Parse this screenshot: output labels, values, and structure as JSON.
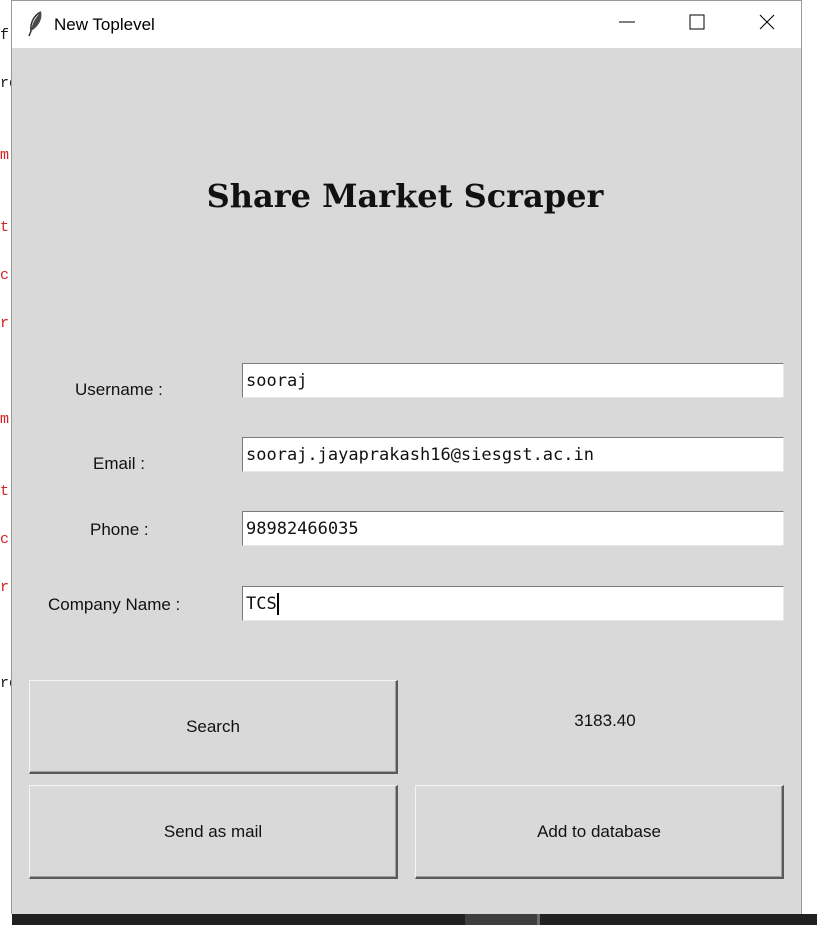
{
  "background_code": {
    "glyphs": [
      "f",
      "rd",
      "m",
      "t",
      "c",
      "r",
      "m",
      "t",
      "c",
      "r",
      "rd"
    ]
  },
  "window": {
    "title": "New Toplevel",
    "icon": "feather-icon",
    "controls": {
      "minimize": "minimize-icon",
      "maximize": "maximize-icon",
      "close": "close-icon"
    }
  },
  "heading": "Share Market Scraper",
  "form": {
    "username": {
      "label": "Username :",
      "value": "sooraj"
    },
    "email": {
      "label": "Email :",
      "value": "sooraj.jayaprakash16@siesgst.ac.in"
    },
    "phone": {
      "label": "Phone :",
      "value": "98982466035"
    },
    "company": {
      "label": "Company Name :",
      "value": "TCS"
    }
  },
  "buttons": {
    "search": "Search",
    "send_mail": "Send as mail",
    "add_db": "Add to database"
  },
  "result": "3183.40",
  "colors": {
    "window_bg": "#d9d9d9",
    "titlebar_bg": "#ffffff",
    "code_red": "#d42020"
  }
}
